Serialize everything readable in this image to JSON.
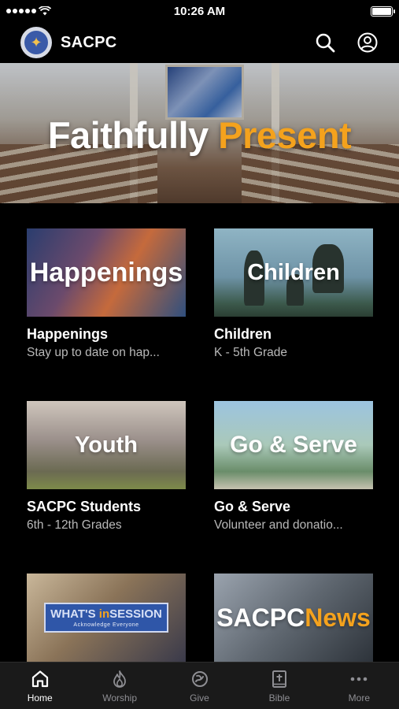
{
  "status_bar": {
    "time": "10:26 AM",
    "signal_bars": 5,
    "wifi_icon": "wifi-icon",
    "battery_level": 1.0
  },
  "header": {
    "app_title": "SACPC",
    "logo_icon": "church-logo",
    "search_icon": "search-icon",
    "account_icon": "account-icon"
  },
  "hero": {
    "title_part1": "Faithfully",
    "title_part2": "Present",
    "accent_color": "#f4a21d"
  },
  "cards": [
    {
      "thumb_text": "Happenings",
      "title": "Happenings",
      "subtitle": "Stay up to date on hap..."
    },
    {
      "thumb_text": "Children",
      "title": "Children",
      "subtitle": "K - 5th Grade"
    },
    {
      "thumb_text": "Youth",
      "title": "SACPC Students",
      "subtitle": "6th - 12th Grades"
    },
    {
      "thumb_text": "Go & Serve",
      "title": "Go & Serve",
      "subtitle": "Volunteer and donatio..."
    },
    {
      "thumb_text_a": "WHAT'S ",
      "thumb_text_b": "in",
      "thumb_text_c": "SESSION",
      "thumb_text_small": "Acknowledge Everyone"
    },
    {
      "thumb_text_a": "SACPC",
      "thumb_text_b": "News"
    }
  ],
  "tabbar": {
    "items": [
      {
        "label": "Home",
        "icon": "home-icon",
        "active": true
      },
      {
        "label": "Worship",
        "icon": "flame-icon",
        "active": false
      },
      {
        "label": "Give",
        "icon": "give-icon",
        "active": false
      },
      {
        "label": "Bible",
        "icon": "bible-icon",
        "active": false
      },
      {
        "label": "More",
        "icon": "more-icon",
        "active": false
      }
    ]
  }
}
